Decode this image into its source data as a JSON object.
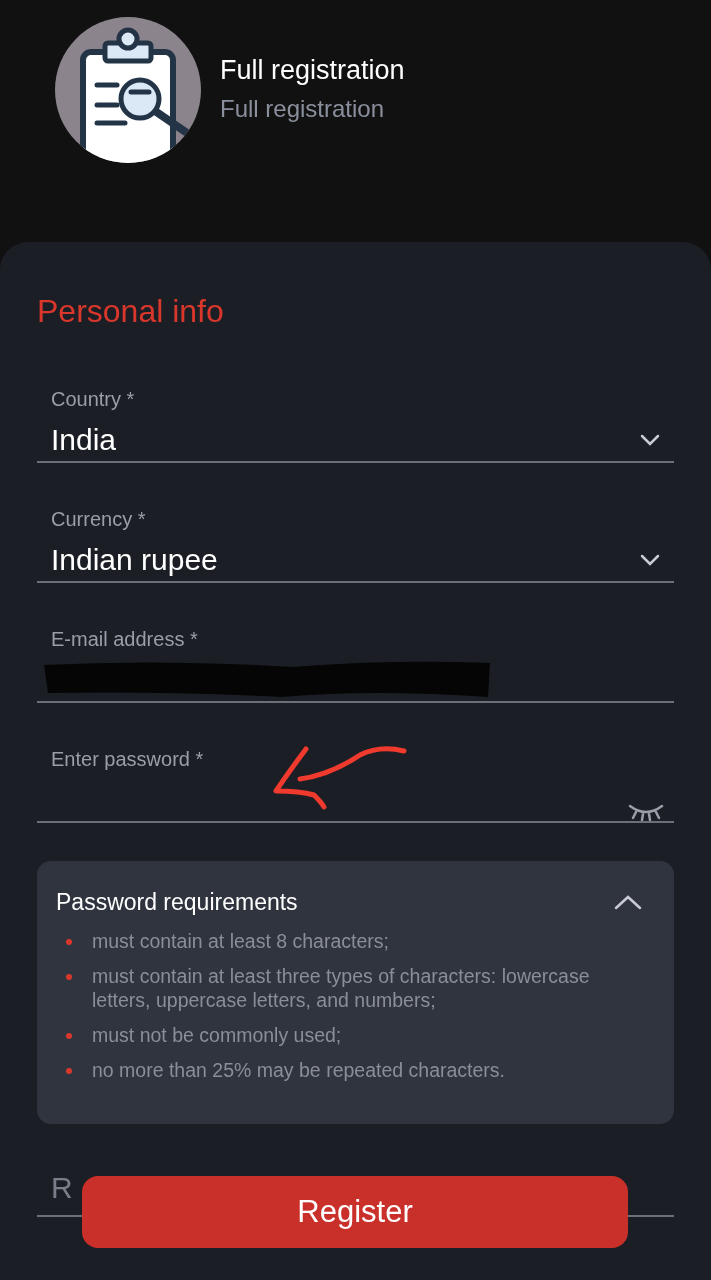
{
  "header": {
    "title": "Full registration",
    "subtitle": "Full registration"
  },
  "section_title": "Personal info",
  "fields": [
    {
      "kind": "select",
      "label": "Country *",
      "value": "India"
    },
    {
      "kind": "select",
      "label": "Currency *",
      "value": "Indian rupee"
    },
    {
      "kind": "email",
      "label": "E-mail address *",
      "redacted": true
    },
    {
      "kind": "password",
      "label": "Enter password *",
      "annotation_arrow": true
    }
  ],
  "requirements": {
    "title": "Password requirements",
    "expanded": true,
    "items": [
      "must contain at least 8 characters;",
      "must contain at least three types of characters: lowercase letters, uppercase letters, and numbers;",
      "must not be commonly used;",
      "no more than 25% may be repeated characters."
    ]
  },
  "repeat_field": {
    "label": "R"
  },
  "register_button": "Register"
}
